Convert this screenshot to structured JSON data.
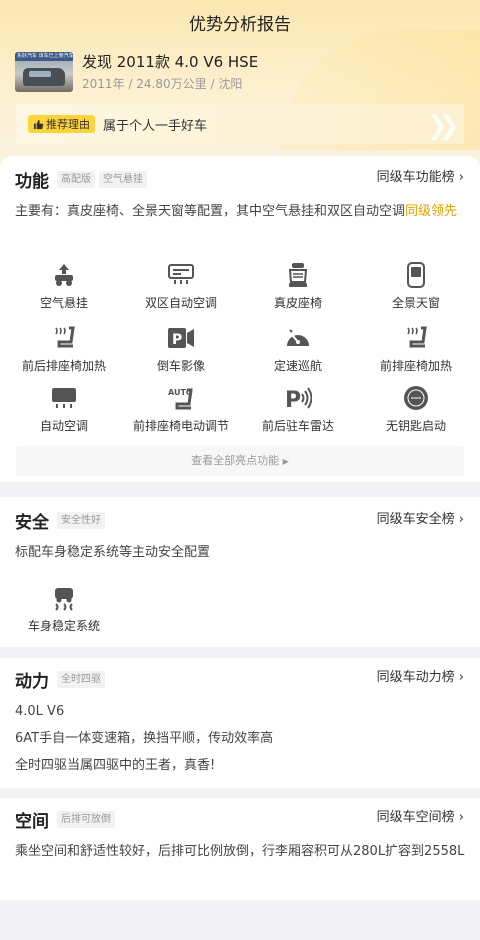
{
  "header": {
    "title": "优势分析报告"
  },
  "car": {
    "thumb_caption": "东好汽车 该车已上架汽车",
    "name": "发现 2011款 4.0 V6 HSE",
    "year": "2011年",
    "mileage": "24.80万公里",
    "city": "沈阳",
    "separator": "/"
  },
  "reason": {
    "badge_label": "推荐理由",
    "text": "属于个人一手好车"
  },
  "features": {
    "title": "功能",
    "tags": [
      "高配版",
      "空气悬挂"
    ],
    "rank_label": "同级车功能榜",
    "desc_main": "主要有：真皮座椅、全景天窗等配置，其中空气悬挂和双区自动空调",
    "desc_highlight": "同级领先",
    "items": [
      {
        "label": "空气悬挂",
        "icon": "air-suspension-icon"
      },
      {
        "label": "双区自动空调",
        "icon": "dual-zone-ac-icon"
      },
      {
        "label": "真皮座椅",
        "icon": "leather-seat-icon"
      },
      {
        "label": "全景天窗",
        "icon": "panoramic-sunroof-icon"
      },
      {
        "label": "前后排座椅加热",
        "icon": "seat-heating-icon"
      },
      {
        "label": "倒车影像",
        "icon": "reverse-camera-icon"
      },
      {
        "label": "定速巡航",
        "icon": "cruise-control-icon"
      },
      {
        "label": "前排座椅加热",
        "icon": "front-seat-heating-icon"
      },
      {
        "label": "自动空调",
        "icon": "auto-ac-icon"
      },
      {
        "label": "前排座椅电动调节",
        "icon": "power-seat-icon"
      },
      {
        "label": "前后驻车雷达",
        "icon": "parking-radar-icon"
      },
      {
        "label": "无钥匙启动",
        "icon": "keyless-start-icon"
      }
    ],
    "more_label": "查看全部亮点功能"
  },
  "safety": {
    "title": "安全",
    "tag": "安全性好",
    "rank_label": "同级车安全榜",
    "desc": "标配车身稳定系统等主动安全配置",
    "item_label": "车身稳定系统"
  },
  "power": {
    "title": "动力",
    "tag": "全时四驱",
    "rank_label": "同级车动力榜",
    "lines": [
      "4.0L V6",
      "6AT手自一体变速箱，换挡平顺，传动效率高",
      "全时四驱当属四驱中的王者，真香!"
    ]
  },
  "space": {
    "title": "空间",
    "tag": "后排可放倒",
    "rank_label": "同级车空间榜",
    "desc": "乘坐空间和舒适性较好，后排可比例放倒，行李厢容积可从280L扩容到2558L"
  },
  "colors": {
    "accent": "#e0a100",
    "badge": "#ffd43a",
    "hero": "#fbe7b0"
  }
}
